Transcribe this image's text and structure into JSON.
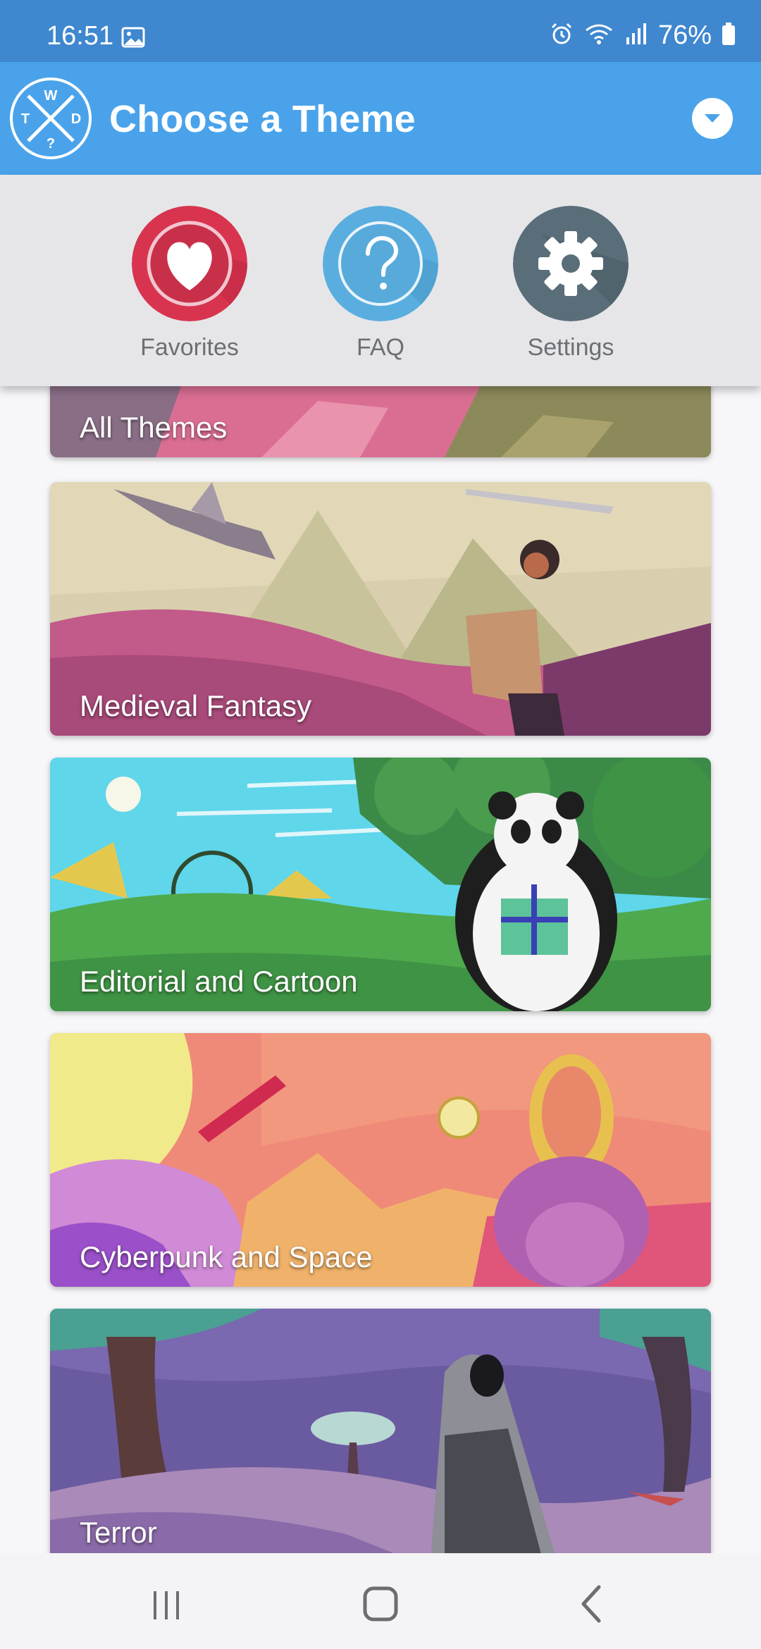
{
  "status_bar": {
    "time": "16:51",
    "battery_text": "76%",
    "icons": [
      "gallery-icon",
      "alarm-icon",
      "wifi-icon",
      "signal-icon",
      "battery-icon"
    ]
  },
  "app_bar": {
    "title": "Choose a Theme",
    "logo_letters": [
      "W",
      "T",
      "D",
      "?"
    ],
    "menu_icon": "chevron-down-icon",
    "color": "#4aa3ea"
  },
  "quick_actions": [
    {
      "label": "Favorites",
      "icon": "heart-icon",
      "color": "#d8344f"
    },
    {
      "label": "FAQ",
      "icon": "question-icon",
      "color": "#5aaedf"
    },
    {
      "label": "Settings",
      "icon": "gear-icon",
      "color": "#5a6e7a"
    }
  ],
  "themes": [
    {
      "title": "All Themes"
    },
    {
      "title": "Medieval Fantasy"
    },
    {
      "title": "Editorial and Cartoon"
    },
    {
      "title": "Cyberpunk and Space"
    },
    {
      "title": "Terror"
    }
  ],
  "nav_bar": {
    "buttons": [
      "recents-icon",
      "home-icon",
      "back-icon"
    ]
  }
}
